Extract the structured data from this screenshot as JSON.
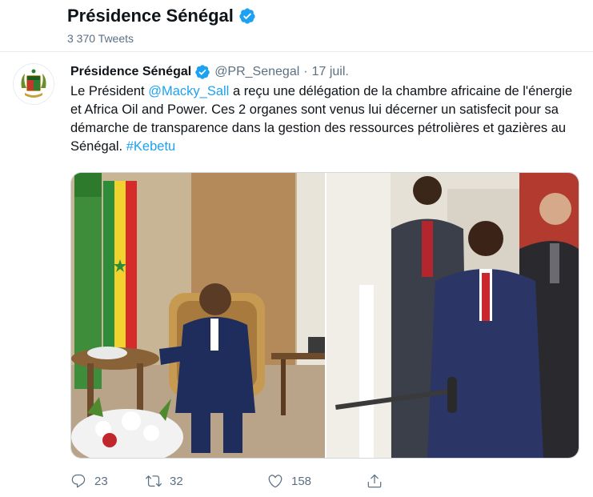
{
  "profile": {
    "name": "Présidence Sénégal",
    "tweet_count": "3 370 Tweets"
  },
  "tweet": {
    "author_name": "Présidence Sénégal",
    "handle": "@PR_Senegal",
    "separator": "·",
    "date": "17 juil.",
    "text_before": "Le Président ",
    "mention": "@Macky_Sall",
    "text_after": " a reçu une délégation de la chambre africaine de l'énergie et Africa Oil and Power. Ces 2 organes sont venus lui décerner un satisfecit pour sa démarche de transparence dans la gestion des ressources pétrolières et gazières au Sénégal. ",
    "hashtag": "#Kebetu"
  },
  "actions": {
    "replies": "23",
    "retweets": "32",
    "likes": "158"
  },
  "colors": {
    "accent": "#1da1f2",
    "muted": "#5b7083",
    "verified": "#1da1f2"
  },
  "icons": [
    "verified-badge-icon",
    "reply-icon",
    "retweet-icon",
    "like-icon",
    "share-icon"
  ]
}
